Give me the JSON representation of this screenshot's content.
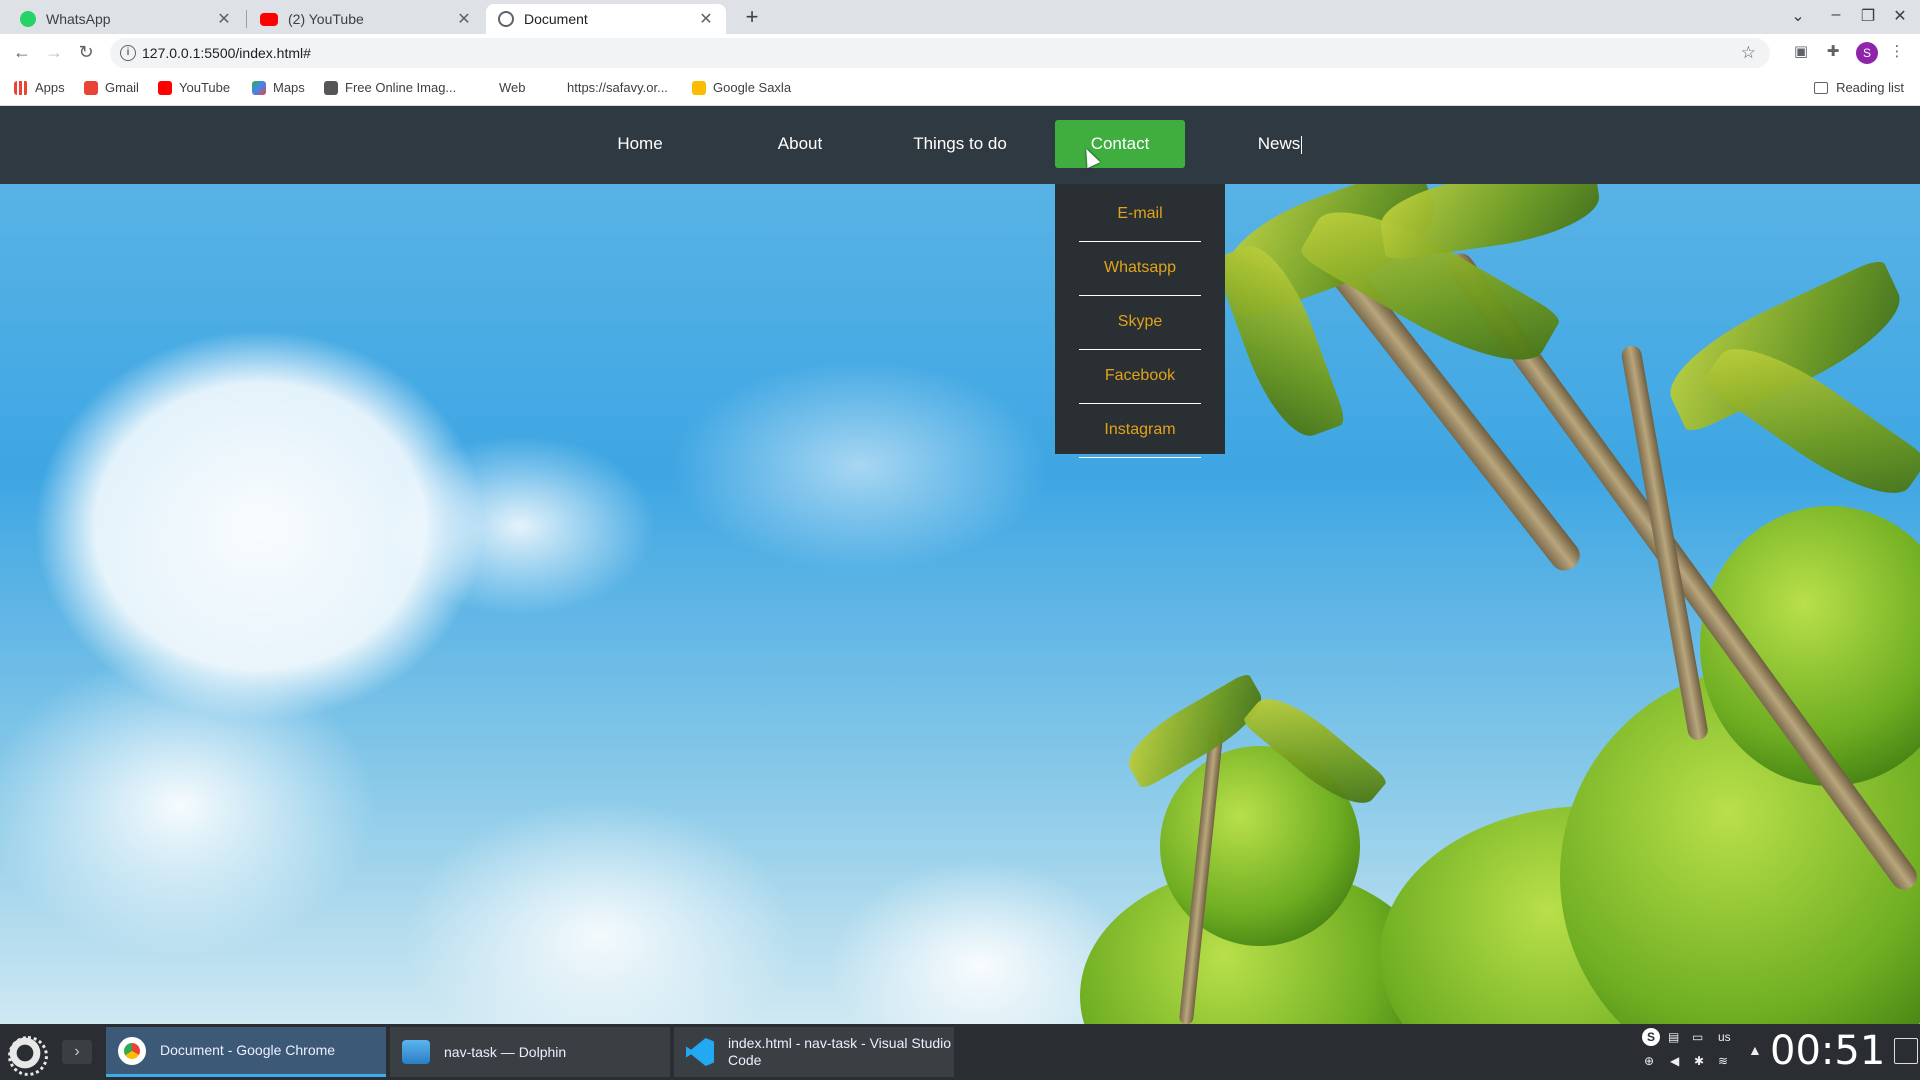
{
  "browser": {
    "tabs": [
      {
        "label": "WhatsApp",
        "close": "✕"
      },
      {
        "label": "(2) YouTube",
        "close": "✕"
      },
      {
        "label": "Document",
        "close": "✕"
      }
    ],
    "new_tab": "+",
    "window_controls": {
      "menu": "⌄",
      "minimize": "–",
      "restore": "❐",
      "close": "✕"
    },
    "url": "127.0.0.1:5500/index.html#",
    "bookmarks": [
      {
        "label": "Apps",
        "icon": "apps-grid-icon"
      },
      {
        "label": "Gmail",
        "icon": "gmail-icon"
      },
      {
        "label": "YouTube",
        "icon": "youtube-icon"
      },
      {
        "label": "Maps",
        "icon": "maps-icon"
      },
      {
        "label": "Free Online Imag...",
        "icon": "oie-icon"
      },
      {
        "label": "Web",
        "icon": "web-icon"
      },
      {
        "label": "https://safavy.or...",
        "icon": "page-icon"
      },
      {
        "label": "Google Saxla",
        "icon": "keep-icon"
      }
    ],
    "reading_list": "Reading list",
    "profile_initial": "S"
  },
  "site": {
    "nav": [
      {
        "label": "Home"
      },
      {
        "label": "About"
      },
      {
        "label": "Things to do"
      },
      {
        "label": "Contact"
      },
      {
        "label": "News"
      }
    ],
    "contact_dropdown": [
      {
        "label": "E-mail"
      },
      {
        "label": "Whatsapp"
      },
      {
        "label": "Skype"
      },
      {
        "label": "Facebook"
      },
      {
        "label": "Instagram"
      }
    ],
    "colors": {
      "navbar": "#2f3942",
      "active": "#3fae3f",
      "dropdown_text": "#e0a31a"
    }
  },
  "taskbar": {
    "tasks": [
      {
        "label": "Document - Google Chrome"
      },
      {
        "label": "nav-task — Dolphin"
      },
      {
        "label": "index.html - nav-task - Visual Studio Code"
      }
    ],
    "keyboard_layout": "us",
    "clock": "00:51"
  }
}
